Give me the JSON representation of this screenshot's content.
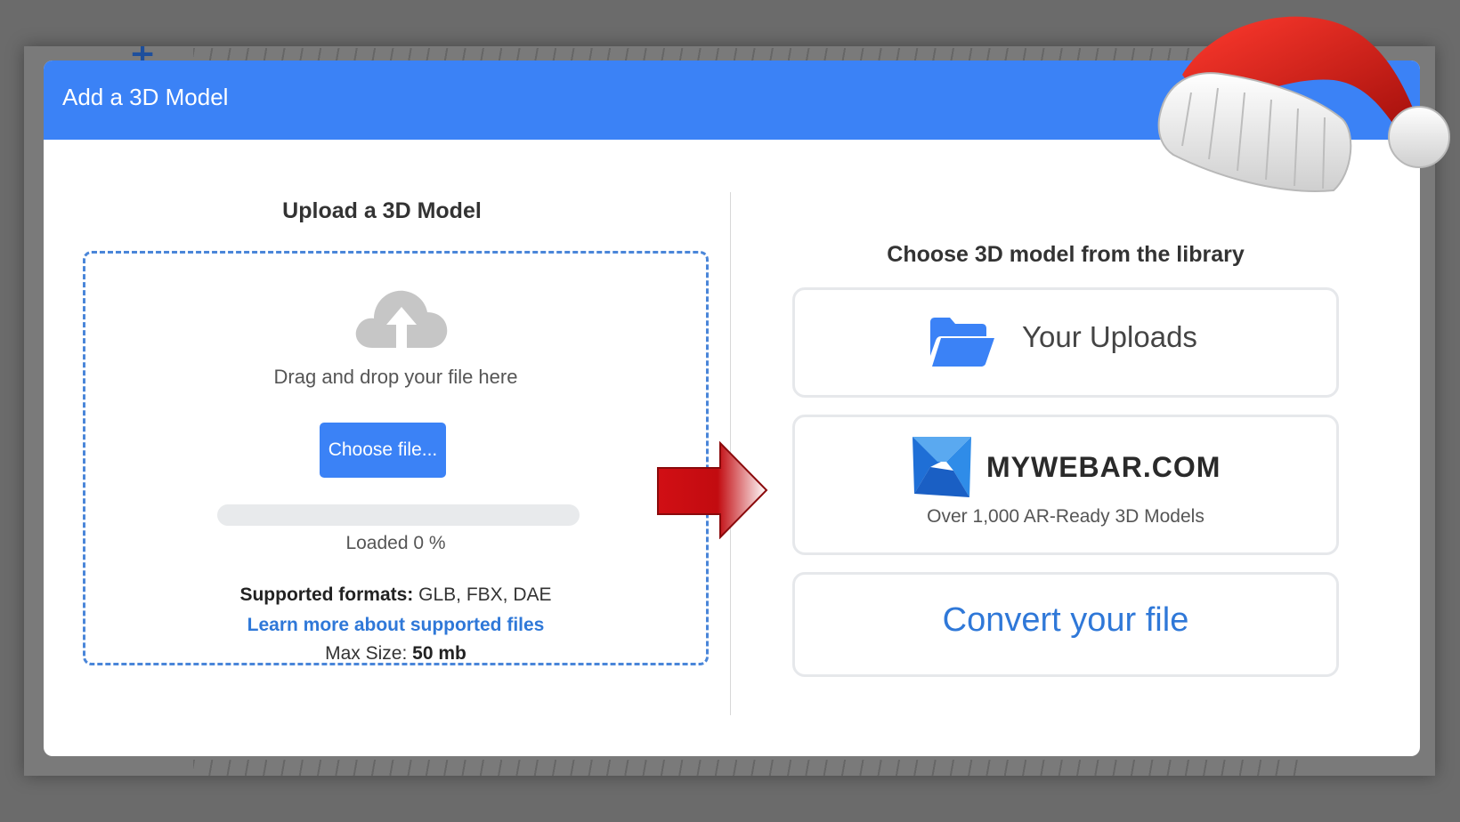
{
  "dialog": {
    "title": "Add a 3D Model"
  },
  "upload": {
    "heading": "Upload a 3D Model",
    "drag_text": "Drag and drop your file here",
    "choose_button": "Choose file...",
    "progress_percent": 0,
    "loaded_text": "Loaded 0 %",
    "formats_label": "Supported formats:",
    "formats_value": " GLB, FBX, DAE",
    "learn_link": "Learn more about supported files",
    "max_size_label": "Max Size:",
    "max_size_value": " 50 mb"
  },
  "library": {
    "heading": "Choose 3D model from the library",
    "uploads_label": "Your Uploads",
    "mywebar_name": "MYWEBAR.COM",
    "mywebar_sub": "Over 1,000 AR-Ready 3D Models",
    "convert_label": "Convert your file"
  },
  "colors": {
    "accent": "#3b82f6",
    "link": "#2f78d8",
    "dropzone_border": "#4a86d9",
    "arrow": "#d10f14"
  },
  "icons": {
    "upload": "cloud-upload-icon",
    "uploads": "folder-open-icon",
    "mywebar": "mywebar-logo-icon",
    "arrow": "right-arrow-icon",
    "decoration": "santa-hat-icon"
  }
}
